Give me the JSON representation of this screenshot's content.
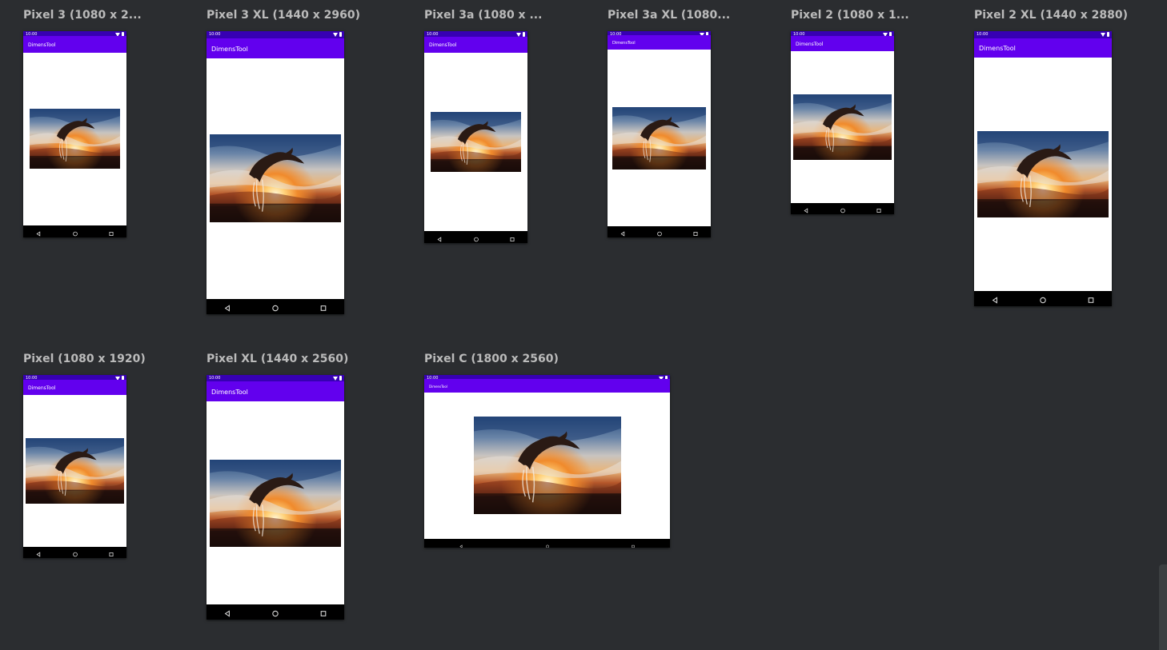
{
  "app_name": "DimensTool",
  "status_time": "10:00",
  "colors": {
    "status_bar": "#3700b3",
    "toolbar": "#6200ee",
    "background": "#2b2d30",
    "title": "#bbbbbb"
  },
  "image": {
    "description_icon": "dolphin-sunset-image"
  },
  "devices": [
    {
      "title": "Pixel 3 (1080 x 2..."
    },
    {
      "title": "Pixel 3 XL (1440 x 2960)"
    },
    {
      "title": "Pixel 3a (1080 x ..."
    },
    {
      "title": "Pixel 3a XL (1080..."
    },
    {
      "title": "Pixel 2 (1080 x 1..."
    },
    {
      "title": "Pixel 2 XL (1440 x 2880)"
    },
    {
      "title": "Pixel (1080 x 1920)"
    },
    {
      "title": "Pixel XL (1440 x 2560)"
    },
    {
      "title": "Pixel C (1800 x 2560)"
    }
  ],
  "nav_icons": [
    "back-icon",
    "home-icon",
    "recents-icon"
  ]
}
